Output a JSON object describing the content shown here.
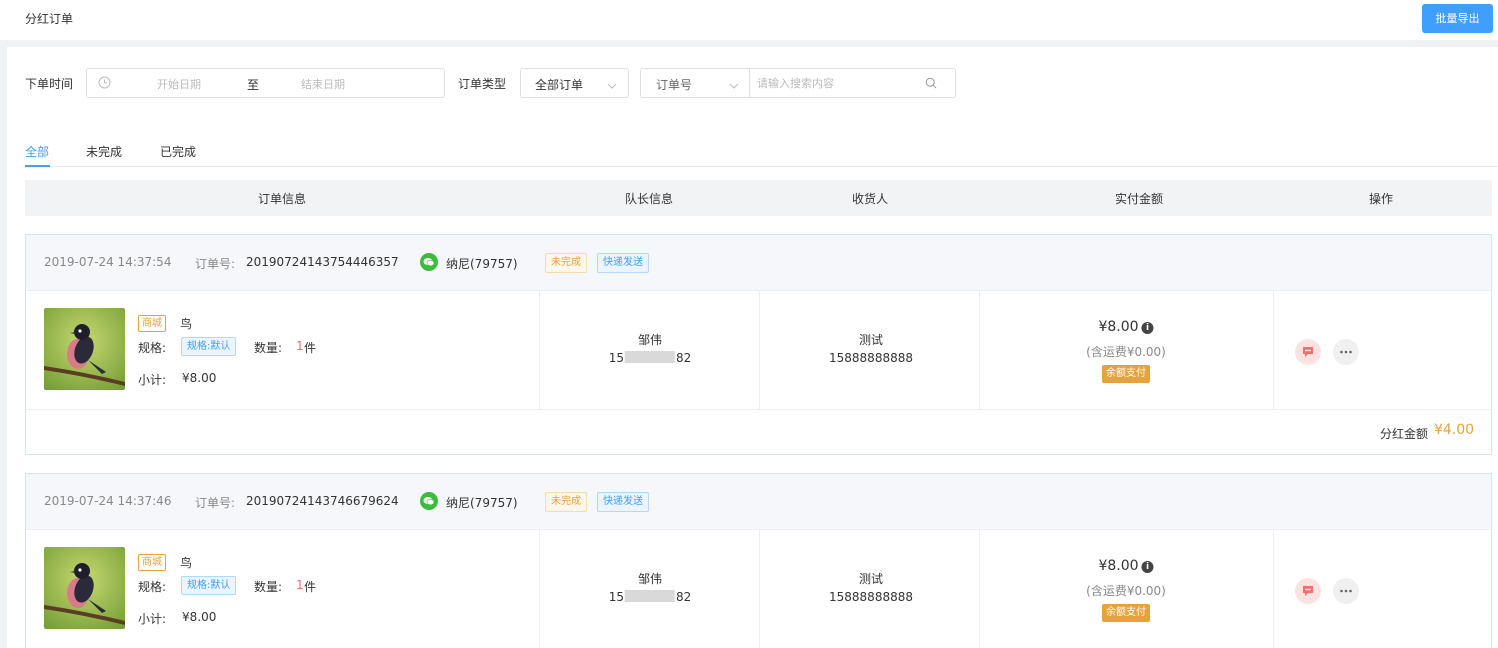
{
  "header": {
    "title": "分红订单",
    "export_label": "批量导出"
  },
  "filters": {
    "time_label": "下单时间",
    "start_placeholder": "开始日期",
    "range_sep": "至",
    "end_placeholder": "结束日期",
    "type_label": "订单类型",
    "type_value": "全部订单",
    "search_field": "订单号",
    "search_placeholder": "请输入搜索内容"
  },
  "tabs": [
    {
      "label": "全部",
      "active": true
    },
    {
      "label": "未完成",
      "active": false
    },
    {
      "label": "已完成",
      "active": false
    }
  ],
  "table_headers": [
    "订单信息",
    "队长信息",
    "收货人",
    "实付金额",
    "操作"
  ],
  "orders": [
    {
      "time": "2019-07-24 14:37:54",
      "order_no_label": "订单号:",
      "order_no": "20190724143754446357",
      "user": "纳尼(79757)",
      "status_tag": "未完成",
      "delivery_tag": "快递发送",
      "source_tag": "商城",
      "product_name": "鸟",
      "spec_label": "规格:",
      "spec_value": "规格:默认",
      "qty_label": "数量:",
      "qty_value": "1",
      "qty_unit": "件",
      "subtotal_label": "小计:",
      "subtotal": "¥8.00",
      "leader_name": "邹伟",
      "leader_phone_prefix": "15",
      "leader_phone_suffix": "82",
      "receiver_name": "测试",
      "receiver_phone": "15888888888",
      "amount": "¥8.00",
      "freight": "(含运费¥0.00)",
      "pay_tag": "余额支付",
      "dividend_label": "分红金额",
      "dividend_value": "¥4.00"
    },
    {
      "time": "2019-07-24 14:37:46",
      "order_no_label": "订单号:",
      "order_no": "20190724143746679624",
      "user": "纳尼(79757)",
      "status_tag": "未完成",
      "delivery_tag": "快递发送",
      "source_tag": "商城",
      "product_name": "鸟",
      "spec_label": "规格:",
      "spec_value": "规格:默认",
      "qty_label": "数量:",
      "qty_value": "1",
      "qty_unit": "件",
      "subtotal_label": "小计:",
      "subtotal": "¥8.00",
      "leader_name": "邹伟",
      "leader_phone_prefix": "15",
      "leader_phone_suffix": "82",
      "receiver_name": "测试",
      "receiver_phone": "15888888888",
      "amount": "¥8.00",
      "freight": "(含运费¥0.00)",
      "pay_tag": "余额支付"
    }
  ],
  "icons": {
    "clock": "clock-icon",
    "chevron": "chevron-down-icon",
    "search": "search-icon",
    "wechat": "wechat-icon",
    "info": "info-icon",
    "message": "message-icon",
    "more": "more-icon"
  },
  "colors": {
    "primary": "#409eff",
    "warning": "#e6a23c",
    "danger": "#f56c6c"
  }
}
